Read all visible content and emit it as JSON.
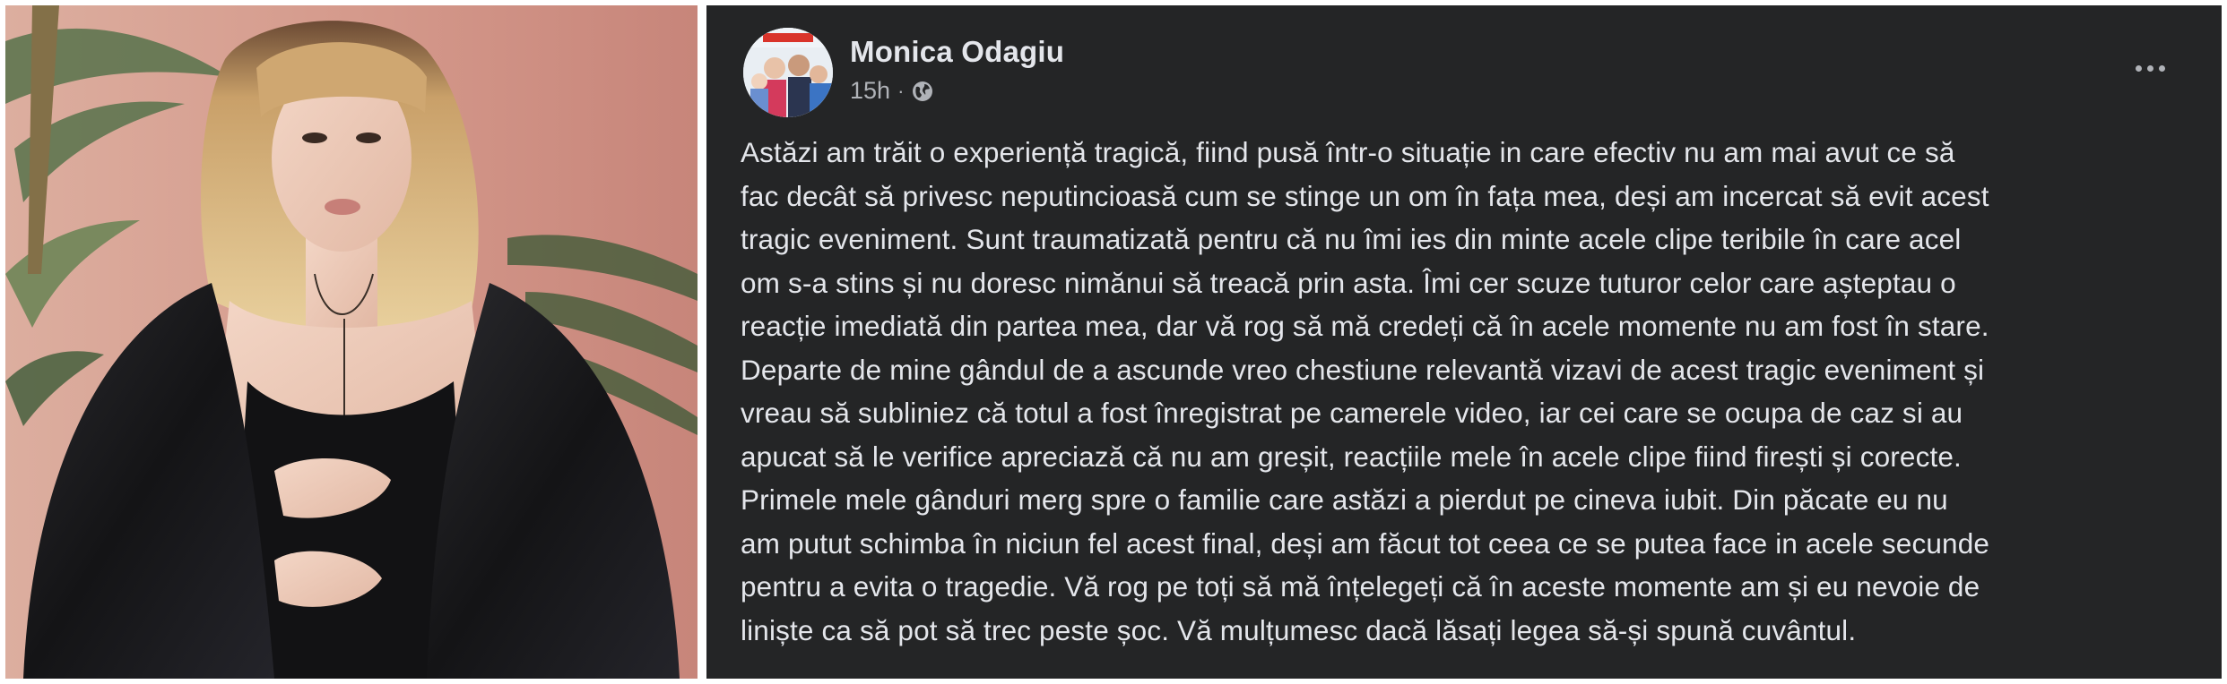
{
  "photo": {
    "description_icon": "portrait-photo"
  },
  "post": {
    "author": "Monica Odagiu",
    "time": "15h",
    "separator": "·",
    "privacy_icon": "globe-icon",
    "more_icon": "more-options-icon",
    "body_lines": [
      "Astăzi am trăit o experiență tragică, fiind pusă într-o situație in care efectiv nu am mai avut ce să",
      "fac decât să privesc neputincioasă cum se stinge un om în fața mea, deși am incercat să evit acest",
      "tragic eveniment. Sunt traumatizată pentru că nu îmi ies din minte acele clipe teribile în care acel",
      "om s-a stins și nu doresc nimănui să treacă prin asta. Îmi cer scuze tuturor celor care așteptau o",
      "reacție imediată din partea mea, dar vă rog să mă credeți că în acele momente nu am fost în stare.",
      "Departe de mine gândul de a ascunde vreo chestiune relevantă vizavi de acest tragic eveniment și",
      "vreau să subliniez că totul a fost înregistrat pe camerele video, iar cei care se ocupa de caz si au",
      "apucat să le verifice apreciază că nu am greșit, reacțiile mele în acele clipe fiind firești și corecte.",
      "Primele mele gânduri merg spre o familie care astăzi a pierdut pe cineva iubit. Din păcate eu nu",
      "am putut schimba în niciun fel acest final, deși am făcut tot ceea ce se putea face in acele secunde",
      "pentru a evita o tragedie. Vă rog pe toți să mă înțelegeți că în aceste momente am și eu nevoie de",
      "liniște ca să pot să trec peste șoc. Vă mulțumesc  dacă lăsați legea să-și spună cuvântul."
    ]
  },
  "colors": {
    "post_background": "#242526",
    "text_primary": "#e4e6eb",
    "text_secondary": "#b0b3b8",
    "photo_background": "#d89b8f"
  }
}
